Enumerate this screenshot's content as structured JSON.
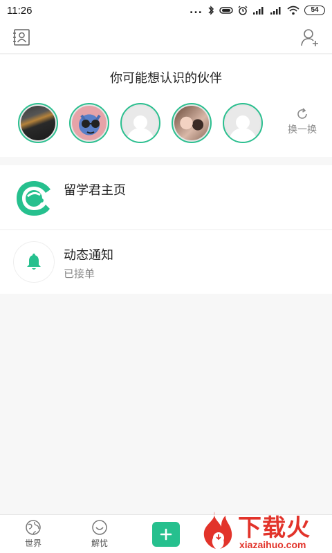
{
  "status_bar": {
    "time": "11:26",
    "dots": "...",
    "battery": "54"
  },
  "suggestions": {
    "title": "你可能想认识的伙伴",
    "refresh_label": "换一换",
    "avatars": [
      "photo",
      "cartoon",
      "default",
      "photo",
      "default"
    ]
  },
  "list": {
    "items": [
      {
        "title": "留学君主页",
        "subtitle": ""
      },
      {
        "title": "动态通知",
        "subtitle": "已接单"
      }
    ]
  },
  "bottom_nav": {
    "tabs": [
      {
        "label": "世界",
        "icon": "globe-icon"
      },
      {
        "label": "解忧",
        "icon": "smile-icon"
      }
    ],
    "add_icon": "plus-icon"
  },
  "watermark": {
    "big": "下载火",
    "small": "xiazaihuo.com"
  },
  "colors": {
    "accent": "#26c08e",
    "watermark": "#e2332a"
  }
}
